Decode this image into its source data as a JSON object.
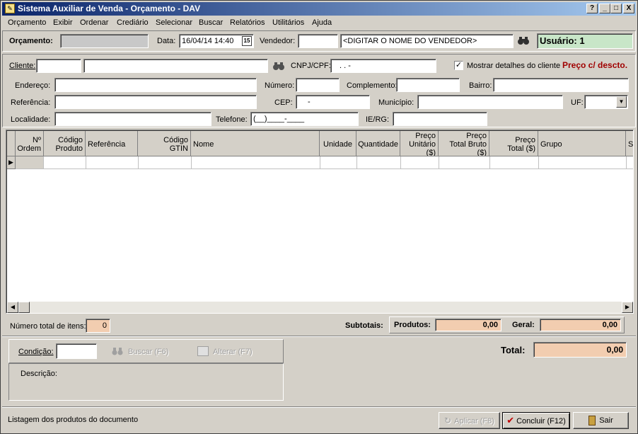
{
  "window": {
    "title": "Sistema Auxiliar de Venda - Orçamento - DAV",
    "controls": [
      "?",
      "_",
      "□",
      "X"
    ]
  },
  "menu": [
    "Orçamento",
    "Exibir",
    "Ordenar",
    "Crediário",
    "Selecionar",
    "Buscar",
    "Relatórios",
    "Utilitários",
    "Ajuda"
  ],
  "header": {
    "orcamento_label": "Orçamento:",
    "data_label": "Data:",
    "data_value": "16/04/14 14:40",
    "vendedor_label": "Vendedor:",
    "vendedor_name_placeholder": "<DIGITAR O NOME DO VENDEDOR>",
    "usuario": "Usuário: 1"
  },
  "cliente": {
    "cliente_label": "Cliente:",
    "cnpj_label": "CNPJ/CPF:",
    "cnpj_mask": ".   .   -",
    "mostrar_detalhes": "Mostrar detalhes do cliente",
    "mostrar_checked": true,
    "preco_label": "Preço c/ descto.",
    "endereco_label": "Endereço:",
    "numero_label": "Número:",
    "complemento_label": "Complemento:",
    "bairro_label": "Bairro:",
    "referencia_label": "Referência:",
    "cep_label": "CEP:",
    "cep_mask": "-",
    "municipio_label": "Município:",
    "uf_label": "UF:",
    "localidade_label": "Localidade:",
    "telefone_label": "Telefone:",
    "telefone_mask": "(__)____-____",
    "ie_label": "IE/RG:"
  },
  "grid": {
    "columns": [
      {
        "l1": "Nº",
        "l2": "Ordem"
      },
      {
        "l1": "Código",
        "l2": "Produto"
      },
      {
        "l1": "",
        "l2": "Referência"
      },
      {
        "l1": "Código",
        "l2": "GTIN"
      },
      {
        "l1": "",
        "l2": "Nome"
      },
      {
        "l1": "",
        "l2": "Unidade"
      },
      {
        "l1": "",
        "l2": "Quantidade"
      },
      {
        "l1": "Preço",
        "l2": "Unitário ($)"
      },
      {
        "l1": "Preço",
        "l2": "Total Bruto ($)"
      },
      {
        "l1": "Preço",
        "l2": "Total ($)"
      },
      {
        "l1": "",
        "l2": "Grupo"
      },
      {
        "l1": "",
        "l2": "S"
      }
    ]
  },
  "totals": {
    "numero_itens_label": "Número total de itens:",
    "numero_itens": "0",
    "subtotais_label": "Subtotais:",
    "produtos_label": "Produtos:",
    "produtos_value": "0,00",
    "geral_label": "Geral:",
    "geral_value": "0,00",
    "total_label": "Total:",
    "total_value": "0,00"
  },
  "condicao": {
    "label": "Condição:",
    "buscar": "Buscar (F6)",
    "alterar": "Alterar (F7)",
    "descricao_label": "Descrição:"
  },
  "footer": {
    "status": "Listagem dos produtos do documento",
    "aplicar": "Aplicar (F8)",
    "concluir": "Concluir (F12)",
    "sair": "Sair"
  },
  "colors": {
    "title_start": "#0a246a",
    "title_end": "#a6caf0",
    "usuario_bg": "#c8e6c8",
    "peach": "#f2cdb0",
    "preco_red": "#a00000"
  }
}
